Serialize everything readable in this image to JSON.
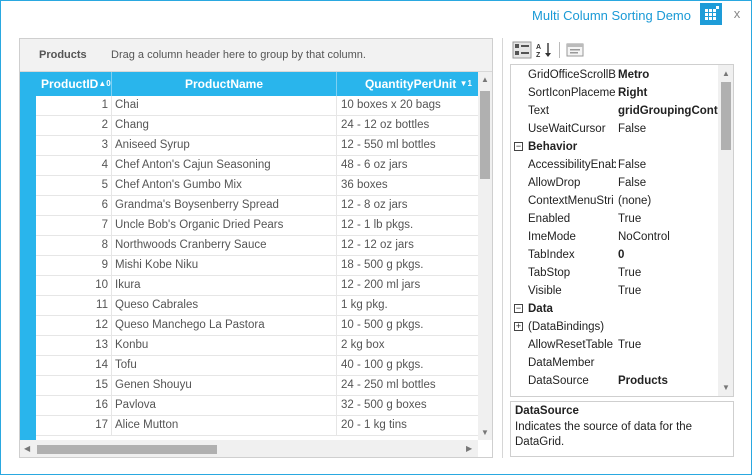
{
  "window": {
    "title": "Multi Column Sorting Demo",
    "close_glyph": "x",
    "accent": "#29b5ec"
  },
  "grid": {
    "group_tag": "Products",
    "group_hint": "Drag a column header here to group by that column.",
    "columns": [
      {
        "label": "ProductID",
        "sort_indicator": "▲0"
      },
      {
        "label": "ProductName",
        "sort_indicator": ""
      },
      {
        "label": "QuantityPerUnit",
        "sort_indicator": "▼1"
      }
    ],
    "rows": [
      {
        "id": "1",
        "name": "Chai",
        "qty": "10 boxes x 20 bags"
      },
      {
        "id": "2",
        "name": "Chang",
        "qty": "24 - 12 oz bottles"
      },
      {
        "id": "3",
        "name": "Aniseed Syrup",
        "qty": "12 - 550 ml bottles"
      },
      {
        "id": "4",
        "name": "Chef Anton's Cajun Seasoning",
        "qty": "48 - 6 oz jars"
      },
      {
        "id": "5",
        "name": "Chef Anton's Gumbo Mix",
        "qty": "36 boxes"
      },
      {
        "id": "6",
        "name": "Grandma's Boysenberry Spread",
        "qty": "12 - 8 oz jars"
      },
      {
        "id": "7",
        "name": "Uncle Bob's Organic Dried Pears",
        "qty": "12 - 1 lb pkgs."
      },
      {
        "id": "8",
        "name": "Northwoods Cranberry Sauce",
        "qty": "12 - 12 oz jars"
      },
      {
        "id": "9",
        "name": "Mishi Kobe Niku",
        "qty": "18 - 500 g pkgs."
      },
      {
        "id": "10",
        "name": "Ikura",
        "qty": "12 - 200 ml jars"
      },
      {
        "id": "11",
        "name": "Queso Cabrales",
        "qty": "1 kg pkg."
      },
      {
        "id": "12",
        "name": "Queso Manchego La Pastora",
        "qty": "10 - 500 g pkgs."
      },
      {
        "id": "13",
        "name": "Konbu",
        "qty": "2 kg box"
      },
      {
        "id": "14",
        "name": "Tofu",
        "qty": "40 - 100 g pkgs."
      },
      {
        "id": "15",
        "name": "Genen Shouyu",
        "qty": "24 - 250 ml bottles"
      },
      {
        "id": "16",
        "name": "Pavlova",
        "qty": "32 - 500 g boxes"
      },
      {
        "id": "17",
        "name": "Alice Mutton",
        "qty": "20 - 1 kg tins"
      }
    ]
  },
  "property_grid": {
    "items": [
      {
        "kind": "prop",
        "name": "GridOfficeScrollB",
        "value": "Metro",
        "bold": true
      },
      {
        "kind": "prop",
        "name": "SortIconPlaceme",
        "value": "Right",
        "bold": true
      },
      {
        "kind": "prop",
        "name": "Text",
        "value": "gridGroupingContr",
        "bold": true
      },
      {
        "kind": "prop",
        "name": "UseWaitCursor",
        "value": "False",
        "bold": false
      },
      {
        "kind": "cat",
        "name": "Behavior",
        "toggle": "−"
      },
      {
        "kind": "prop",
        "name": "AccessibilityEnab",
        "value": "False",
        "bold": false
      },
      {
        "kind": "prop",
        "name": "AllowDrop",
        "value": "False",
        "bold": false
      },
      {
        "kind": "prop",
        "name": "ContextMenuStri",
        "value": "(none)",
        "bold": false
      },
      {
        "kind": "prop",
        "name": "Enabled",
        "value": "True",
        "bold": false
      },
      {
        "kind": "prop",
        "name": "ImeMode",
        "value": "NoControl",
        "bold": false
      },
      {
        "kind": "prop",
        "name": "TabIndex",
        "value": "0",
        "bold": true
      },
      {
        "kind": "prop",
        "name": "TabStop",
        "value": "True",
        "bold": false
      },
      {
        "kind": "prop",
        "name": "Visible",
        "value": "True",
        "bold": false
      },
      {
        "kind": "cat",
        "name": "Data",
        "toggle": "−"
      },
      {
        "kind": "expand",
        "name": "(DataBindings)",
        "value": "",
        "toggle": "+"
      },
      {
        "kind": "prop",
        "name": "AllowResetTable",
        "value": "True",
        "bold": false
      },
      {
        "kind": "prop",
        "name": "DataMember",
        "value": "",
        "bold": false
      },
      {
        "kind": "prop",
        "name": "DataSource",
        "value": "Products",
        "bold": true
      }
    ],
    "description": {
      "title": "DataSource",
      "text": "Indicates the source of data for the DataGrid."
    }
  }
}
